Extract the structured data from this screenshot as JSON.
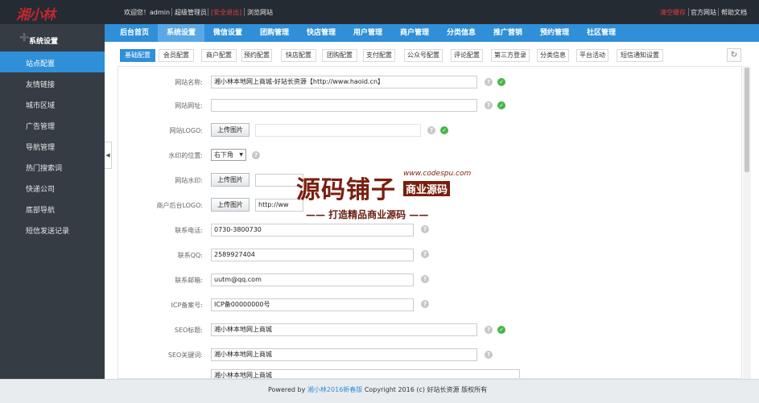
{
  "topbar": {
    "logo": "湘小林",
    "welcome": "欢迎您！admin",
    "role": "超级管理员",
    "logout": "[安全退出]",
    "browse": "浏览网站",
    "clear_cache": "清空缓存",
    "official_site": "官方网站",
    "help_docs": "帮助文档"
  },
  "sidebar": {
    "section_title": "系统设置",
    "items": [
      "站点配置",
      "友情链接",
      "城市区域",
      "广告管理",
      "导航管理",
      "热门搜索词",
      "快递公司",
      "底部导航",
      "短信发送记录"
    ],
    "active_index": 0
  },
  "main_nav": {
    "items": [
      "后台首页",
      "系统设置",
      "微信设置",
      "团购管理",
      "快店管理",
      "用户管理",
      "商户管理",
      "分类信息",
      "推广营销",
      "预约管理",
      "社区管理"
    ],
    "active_index": 1
  },
  "sub_tabs": {
    "items": [
      "基础配置",
      "会员配置",
      "商户配置",
      "预约配置",
      "快店配置",
      "团购配置",
      "支付配置",
      "公众号配置",
      "评论配置",
      "第三方登录",
      "分类信息",
      "平台活动",
      "短信通知设置"
    ],
    "active_index": 0
  },
  "form": {
    "site_name_label": "网站名称:",
    "site_name_value": "湘小林本地网上商城-好站长资源【http://www.haoid.cn】",
    "site_url_label": "网站网址:",
    "site_url_value": "",
    "logo_label": "网站LOGO:",
    "logo_path": "",
    "upload_label": "上传图片",
    "watermark_pos_label": "水印的位置:",
    "watermark_pos_value": "右下角",
    "watermark_label": "网站水印:",
    "watermark_path": "",
    "merchant_logo_label": "商户后台LOGO:",
    "merchant_logo_path": "http://ww",
    "phone_label": "联系电话:",
    "phone_value": "0730-3800730",
    "qq_label": "联系QQ:",
    "qq_value": "2589927404",
    "email_label": "联系邮箱:",
    "email_value": "uutm@qq.com",
    "icp_label": "ICP备案号:",
    "icp_value": "ICP备00000000号",
    "seo_title_label": "SEO标题:",
    "seo_title_value": "湘小林本地网上商城",
    "seo_keywords_label": "SEO关键词:",
    "seo_keywords_value": "湘小林本地网上商城",
    "seo_desc_value": "湘小林本地网上商城"
  },
  "watermark_overlay": {
    "big": "源码铺子",
    "url": "www.codespu.com",
    "tag": "商业源码",
    "sub": "—— 打造精品商业源码 ——"
  },
  "footer": {
    "powered_by": "Powered by",
    "brand_link": "湘小林2016新春版",
    "copyright": "Copyright 2016 (c) 好站长资源 版权所有"
  },
  "colors": {
    "accent": "#2f8fd8",
    "topbar": "#252b33",
    "sidebar": "#353c44",
    "logo_red": "#c1272d",
    "ok_green": "#46b649",
    "watermark_brown": "#7a1f0f"
  }
}
